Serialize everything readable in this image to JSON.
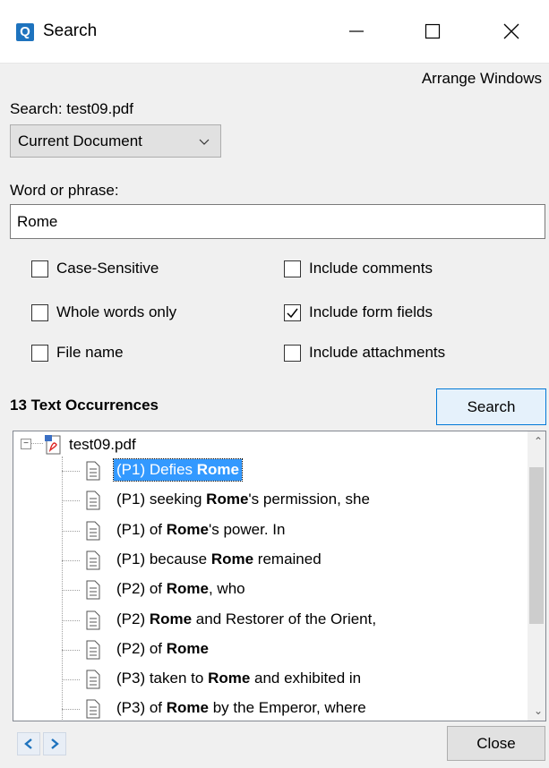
{
  "window": {
    "icon_letter": "Q",
    "title": "Search"
  },
  "arrange_windows": "Arrange Windows",
  "search_in": "Search: test09.pdf",
  "scope": {
    "selected": "Current Document"
  },
  "word_label": "Word or phrase:",
  "word_value": "Rome",
  "options": {
    "case_sensitive": {
      "label": "Case-Sensitive",
      "checked": false
    },
    "whole_words": {
      "label": "Whole words only",
      "checked": false
    },
    "file_name": {
      "label": "File name",
      "checked": false
    },
    "include_comments": {
      "label": "Include comments",
      "checked": false
    },
    "include_form_fields": {
      "label": "Include form fields",
      "checked": true
    },
    "include_attachments": {
      "label": "Include attachments",
      "checked": false
    }
  },
  "occurrences_label": "13 Text Occurrences",
  "search_button": "Search",
  "results": {
    "root": "test09.pdf",
    "items": [
      {
        "before": "(P1) Defies ",
        "match": "Rome",
        "after": "",
        "selected": true
      },
      {
        "before": "(P1) seeking ",
        "match": "Rome",
        "after": "'s permission, she",
        "selected": false
      },
      {
        "before": "(P1) of ",
        "match": "Rome",
        "after": "'s power. In",
        "selected": false
      },
      {
        "before": "(P1) because ",
        "match": "Rome",
        "after": " remained",
        "selected": false
      },
      {
        "before": "(P2) of ",
        "match": "Rome",
        "after": ", who",
        "selected": false
      },
      {
        "before": "(P2) ",
        "match": "Rome",
        "after": " and Restorer of the Orient,",
        "selected": false
      },
      {
        "before": "(P2) of ",
        "match": "Rome",
        "after": "",
        "selected": false
      },
      {
        "before": "(P3) taken to ",
        "match": "Rome",
        "after": " and exhibited in",
        "selected": false
      },
      {
        "before": "(P3) of ",
        "match": "Rome",
        "after": " by the Emperor, where",
        "selected": false
      }
    ]
  },
  "close_button": "Close",
  "colors": {
    "selection": "#3399ff",
    "accent": "#0078d7",
    "app_icon": "#1e73be"
  }
}
